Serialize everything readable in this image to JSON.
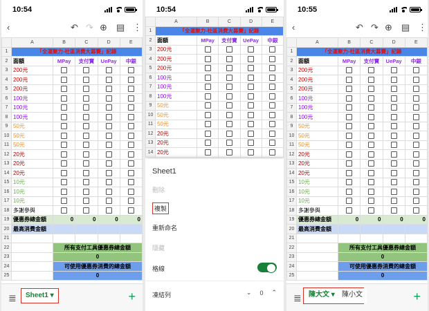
{
  "panels": [
    {
      "time": "10:54"
    },
    {
      "time": "10:54"
    },
    {
      "time": "10:55"
    }
  ],
  "icons": {
    "back": "chevron-left-icon",
    "undo": "undo-icon",
    "redo": "redo-icon",
    "add_person": "add-person-icon",
    "comment": "comment-icon",
    "more": "more-vert-icon"
  },
  "sheet": {
    "columns": [
      "A",
      "B",
      "C",
      "D",
      "E"
    ],
    "title": "「全運聚力-社區消費大募賽」記錄",
    "header": {
      "amount": "面額",
      "mpay": "MPay",
      "alipay": "支付寶",
      "uepay": "UePay",
      "bank": "中銀"
    },
    "rows": [
      {
        "n": "3",
        "label": "200元",
        "color": "#cc0000"
      },
      {
        "n": "4",
        "label": "200元",
        "color": "#cc0000"
      },
      {
        "n": "5",
        "label": "200元",
        "color": "#cc0000"
      },
      {
        "n": "6",
        "label": "100元",
        "color": "#9900ff"
      },
      {
        "n": "7",
        "label": "100元",
        "color": "#9900ff"
      },
      {
        "n": "8",
        "label": "100元",
        "color": "#9900ff"
      },
      {
        "n": "9",
        "label": "50元",
        "color": "#e69138"
      },
      {
        "n": "10",
        "label": "50元",
        "color": "#e69138"
      },
      {
        "n": "11",
        "label": "50元",
        "color": "#e69138"
      },
      {
        "n": "12",
        "label": "20元",
        "color": "#990000"
      },
      {
        "n": "13",
        "label": "20元",
        "color": "#990000"
      },
      {
        "n": "14",
        "label": "20元",
        "color": "#990000"
      },
      {
        "n": "15",
        "label": "10元",
        "color": "#6aa84f"
      },
      {
        "n": "16",
        "label": "10元",
        "color": "#6aa84f"
      },
      {
        "n": "17",
        "label": "10元",
        "color": "#6aa84f"
      },
      {
        "n": "18",
        "label": "多謝參與",
        "color": "#000000"
      }
    ],
    "coupon_total_label": "優惠券總金額",
    "coupon_total_values": [
      "0",
      "0",
      "0",
      "0"
    ],
    "max_spend_label": "最高消費金額",
    "all_coupon_label": "所有支付工具優惠券總金額",
    "all_coupon_value": "0",
    "usable_label": "可使用優惠券消費的總金額",
    "usable_value": "0",
    "row_nums_extra": [
      "19",
      "20",
      "21",
      "22",
      "23",
      "24",
      "25"
    ]
  },
  "tabs": {
    "sheet1": "Sheet1",
    "tab_a": "陳大文",
    "tab_b": "陳小文"
  },
  "menu": {
    "sheet_name": "Sheet1",
    "delete": "刪除",
    "copy": "複製",
    "rename": "重新命名",
    "hide": "隱藏",
    "gridlines": "格線",
    "freeze_rows": "凍結列",
    "freeze_value": "0"
  },
  "colors": {
    "accent_green": "#188038",
    "title_blue": "#4a86e8",
    "highlight_red": "#d93025"
  }
}
